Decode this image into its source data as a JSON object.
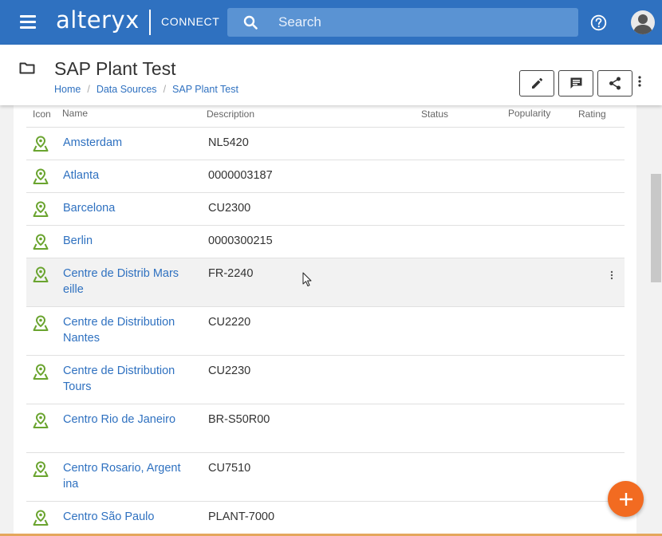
{
  "app": {
    "logo_text": "alteryx",
    "logo_sub": "CONNECT",
    "brand_color": "#2f71c0",
    "accent_color": "#f26b21"
  },
  "search": {
    "placeholder": "Search",
    "value": ""
  },
  "header": {
    "title": "SAP Plant Test",
    "breadcrumb": [
      "Home",
      "Data Sources",
      "SAP Plant Test"
    ],
    "actions": [
      "edit-icon",
      "comment-icon",
      "share-icon",
      "more-vertical-icon"
    ]
  },
  "table": {
    "columns": {
      "icon": "Icon",
      "name": "Name",
      "description": "Description",
      "status": "Status",
      "popularity": "Popularity",
      "rating": "Rating"
    },
    "rows": [
      {
        "name": "Amsterdam",
        "description": "NL5420"
      },
      {
        "name": "Atlanta",
        "description": "0000003187"
      },
      {
        "name": "Barcelona",
        "description": "CU2300"
      },
      {
        "name": "Berlin",
        "description": "0000300215"
      },
      {
        "name": "Centre de Distrib Marseille",
        "description": "FR-2240"
      },
      {
        "name": "Centre de Distribution Nantes",
        "description": "CU2220"
      },
      {
        "name": "Centre de Distribution Tours",
        "description": "CU2230"
      },
      {
        "name": "Centro Rio de Janeiro",
        "description": "BR-S50R00"
      },
      {
        "name": "Centro Rosario, Argentina",
        "description": "CU7510"
      },
      {
        "name": "Centro São Paulo",
        "description": "PLANT-7000"
      }
    ]
  },
  "icons": {
    "row_icon": "map-pin-icon",
    "row_icon_color": "#6aa42f",
    "fab_icon": "plus-icon"
  }
}
